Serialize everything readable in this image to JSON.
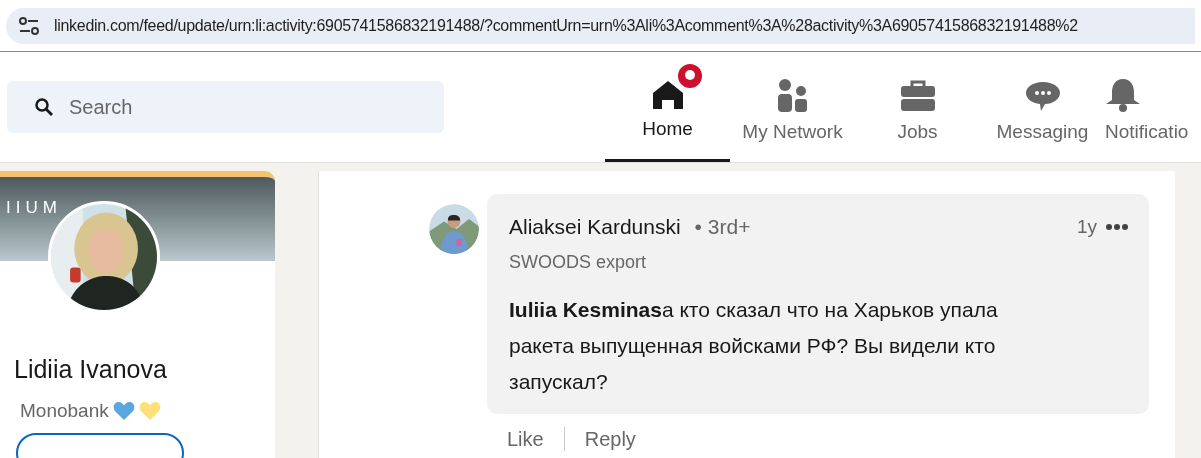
{
  "address_bar": {
    "url": "linkedin.com/feed/update/urn:li:activity:6905741586832191488/?commentUrn=urn%3Ali%3Acomment%3A%28activity%3A6905741586832191488%2"
  },
  "search": {
    "placeholder": "Search"
  },
  "nav": [
    {
      "kind": "home",
      "label": "Home",
      "selected": true,
      "badge": true
    },
    {
      "kind": "network",
      "label": "My Network",
      "selected": false,
      "badge": false
    },
    {
      "kind": "jobs",
      "label": "Jobs",
      "selected": false,
      "badge": false
    },
    {
      "kind": "messaging",
      "label": "Messaging",
      "selected": false,
      "badge": false
    },
    {
      "kind": "notifications",
      "label": "Notificatio",
      "selected": false,
      "badge": false
    }
  ],
  "profile_card": {
    "banner": "IIUM",
    "name": "Lidiia Ivanova",
    "headline": "Monobank"
  },
  "comment": {
    "author": "Aliaksei Kardunski",
    "degree": "• 3rd+",
    "subtitle": "SWOODS export",
    "time": "1y",
    "text": "**Iuliia Kesminas**а кто сказал что на Харьков упала ракета выпущенная войсками РФ? Вы видели кто запускал?",
    "actions": [
      "Like",
      "Reply"
    ]
  }
}
